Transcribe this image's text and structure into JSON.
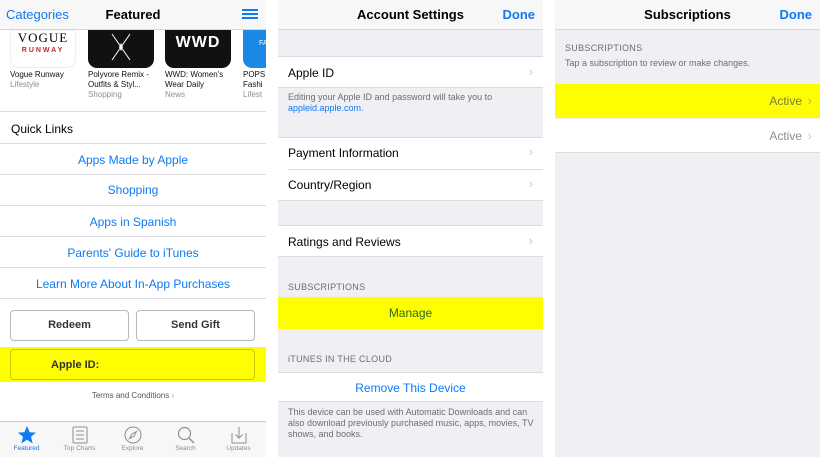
{
  "panel1": {
    "nav": {
      "left": "Categories",
      "title": "Featured"
    },
    "apps": [
      {
        "name": "Vogue Runway",
        "category": "Lifestyle",
        "thumb_text_top": "VOGUE",
        "thumb_text_bottom": "RUNWAY"
      },
      {
        "name": "Polyvore Remix - Outfits & Styl...",
        "category": "Shopping"
      },
      {
        "name": "WWD: Women's Wear Daily",
        "category": "News",
        "thumb_text_top": "WWD"
      },
      {
        "name": "POPS Fashi",
        "category": "Lifest",
        "thumb_text_top": "FA"
      }
    ],
    "quick_links_title": "Quick Links",
    "links": [
      "Apps Made by Apple",
      "Shopping",
      "Apps in Spanish",
      "Parents' Guide to iTunes",
      "Learn More About In-App Purchases"
    ],
    "redeem": "Redeem",
    "send_gift": "Send Gift",
    "apple_id": "Apple ID:",
    "terms": "Terms and Conditions",
    "tabs": [
      "Featured",
      "Top Charts",
      "Explore",
      "Search",
      "Updates"
    ]
  },
  "panel2": {
    "nav": {
      "title": "Account Settings",
      "right": "Done"
    },
    "apple_id_label": "Apple ID",
    "apple_id_note_line1": "Editing your Apple ID and password will take you to",
    "apple_id_note_link": "appleid.apple.com.",
    "payment": "Payment Information",
    "country": "Country/Region",
    "ratings": "Ratings and Reviews",
    "subscriptions_header": "SUBSCRIPTIONS",
    "manage": "Manage",
    "cloud_header": "iTUNES IN THE CLOUD",
    "remove_device": "Remove This Device",
    "cloud_note": "This device can be used with Automatic Downloads and can also download previously purchased music, apps, movies, TV shows, and books."
  },
  "panel3": {
    "nav": {
      "title": "Subscriptions",
      "right": "Done"
    },
    "header": "SUBSCRIPTIONS",
    "subheader": "Tap a subscription to review or make changes.",
    "rows": [
      "Active",
      "Active"
    ]
  },
  "colors": {
    "accent": "#0e7af3",
    "highlight": "#fefe00",
    "grouped_bg": "#efeff4"
  }
}
